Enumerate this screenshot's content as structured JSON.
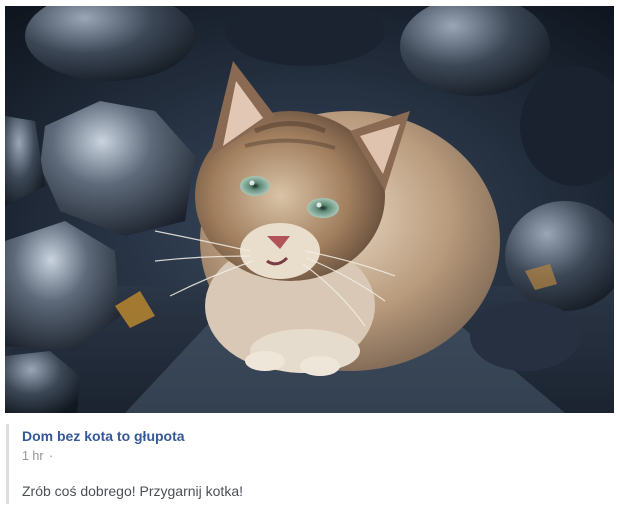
{
  "post": {
    "page_name": "Dom bez kota to głupota",
    "timestamp": "1 hr",
    "separator": "·",
    "text": "Zrób coś dobrego! Przygarnij kotka!"
  },
  "photo": {
    "subject": "kitten-on-coal-photo"
  },
  "colors": {
    "link": "#365899",
    "meta": "#90949c",
    "body_text": "#4b4f56",
    "quote_bar": "#dcdee3"
  }
}
